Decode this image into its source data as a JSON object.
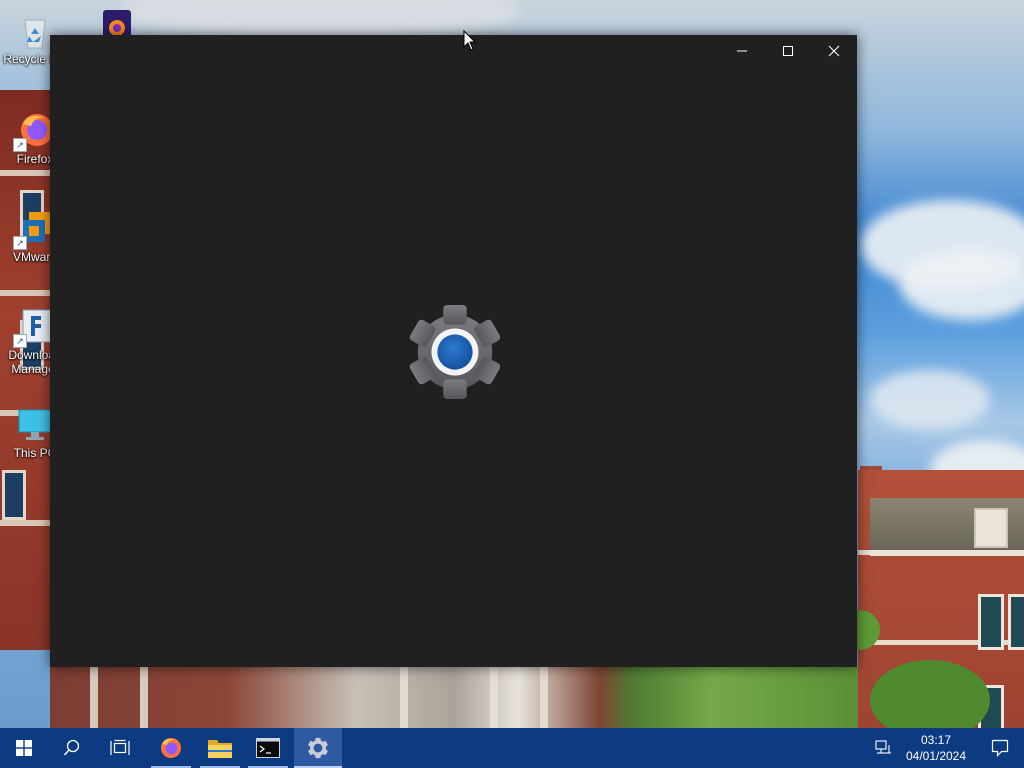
{
  "desktop": {
    "icons": [
      {
        "label": "Recycle Bin",
        "icon": "recycle-bin-icon"
      },
      {
        "label": "Firefox",
        "icon": "firefox-icon"
      },
      {
        "label": "VMware",
        "icon": "vmware-icon"
      },
      {
        "label": "Download Manager",
        "icon": "download-manager-icon"
      },
      {
        "label": "This PC",
        "icon": "this-pc-icon"
      }
    ]
  },
  "window": {
    "app": "Settings",
    "state": "loading",
    "splash_icon": "gear-icon",
    "background": "#202020",
    "accent": "#1e63b6",
    "caption_buttons": [
      "minimize",
      "maximize",
      "close"
    ]
  },
  "taskbar": {
    "buttons": [
      {
        "name": "start",
        "icon": "windows-logo-icon"
      },
      {
        "name": "search",
        "icon": "search-icon"
      },
      {
        "name": "task-view",
        "icon": "task-view-icon"
      },
      {
        "name": "firefox",
        "icon": "firefox-icon",
        "running": true
      },
      {
        "name": "file-explorer",
        "icon": "folder-icon",
        "running": true
      },
      {
        "name": "command-prompt",
        "icon": "terminal-icon",
        "running": true
      },
      {
        "name": "settings",
        "icon": "gear-icon",
        "running": true,
        "active": true
      }
    ],
    "tray": {
      "network_icon": "network-icon",
      "time": "03:17",
      "date": "04/01/2024",
      "notification_icon": "action-center-icon"
    },
    "color": "#0c3b82"
  }
}
